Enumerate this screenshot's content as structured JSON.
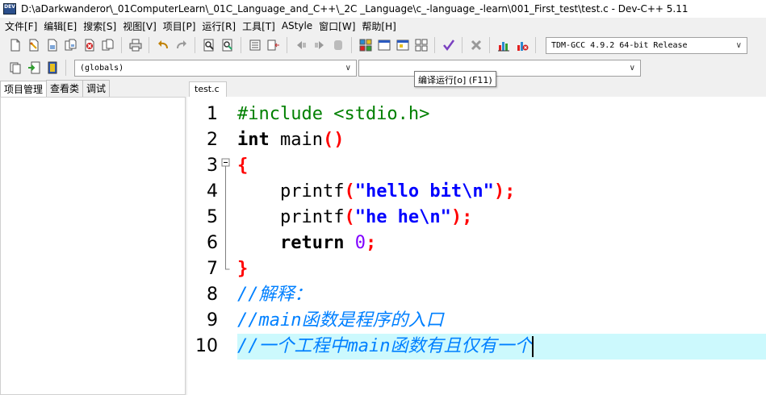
{
  "window": {
    "title": "D:\\aDarkwanderor\\_01ComputerLearn\\_01C_Language_and_C++\\_2C _Language\\c_-language_-learn\\001_First_test\\test.c - Dev-C++ 5.11",
    "icon_label": "DEV"
  },
  "menu": [
    "文件[F]",
    "编辑[E]",
    "搜索[S]",
    "视图[V]",
    "项目[P]",
    "运行[R]",
    "工具[T]",
    "AStyle",
    "窗口[W]",
    "帮助[H]"
  ],
  "toolbar": {
    "compiler_select": "TDM-GCC 4.9.2 64-bit Release",
    "globals_select": "(globals)",
    "members_select": ""
  },
  "tooltip": "编译运行[o] (F11)",
  "left_panel": {
    "tabs": [
      "项目管理",
      "查看类",
      "调试"
    ]
  },
  "editor": {
    "tab": "test.c",
    "lines": [
      {
        "n": "1",
        "text": "#include <stdio.h>"
      },
      {
        "n": "2",
        "text": "int main()"
      },
      {
        "n": "3",
        "text": "{"
      },
      {
        "n": "4",
        "text": "    printf(\"hello bit\\n\");"
      },
      {
        "n": "5",
        "text": "    printf(\"he he\\n\");"
      },
      {
        "n": "6",
        "text": "    return 0;"
      },
      {
        "n": "7",
        "text": "}"
      },
      {
        "n": "8",
        "text": "//解释："
      },
      {
        "n": "9",
        "text": "//main函数是程序的入口"
      },
      {
        "n": "10",
        "text": "//一个工程中main函数有且仅有一个"
      }
    ],
    "active_line": "10"
  },
  "colors": {
    "active_line_bg": "#ccf9fd",
    "preprocessor": "#008000",
    "string": "#0000ff",
    "punctuation": "#ff0000",
    "number": "#8000ff",
    "comment": "#0080ff"
  }
}
